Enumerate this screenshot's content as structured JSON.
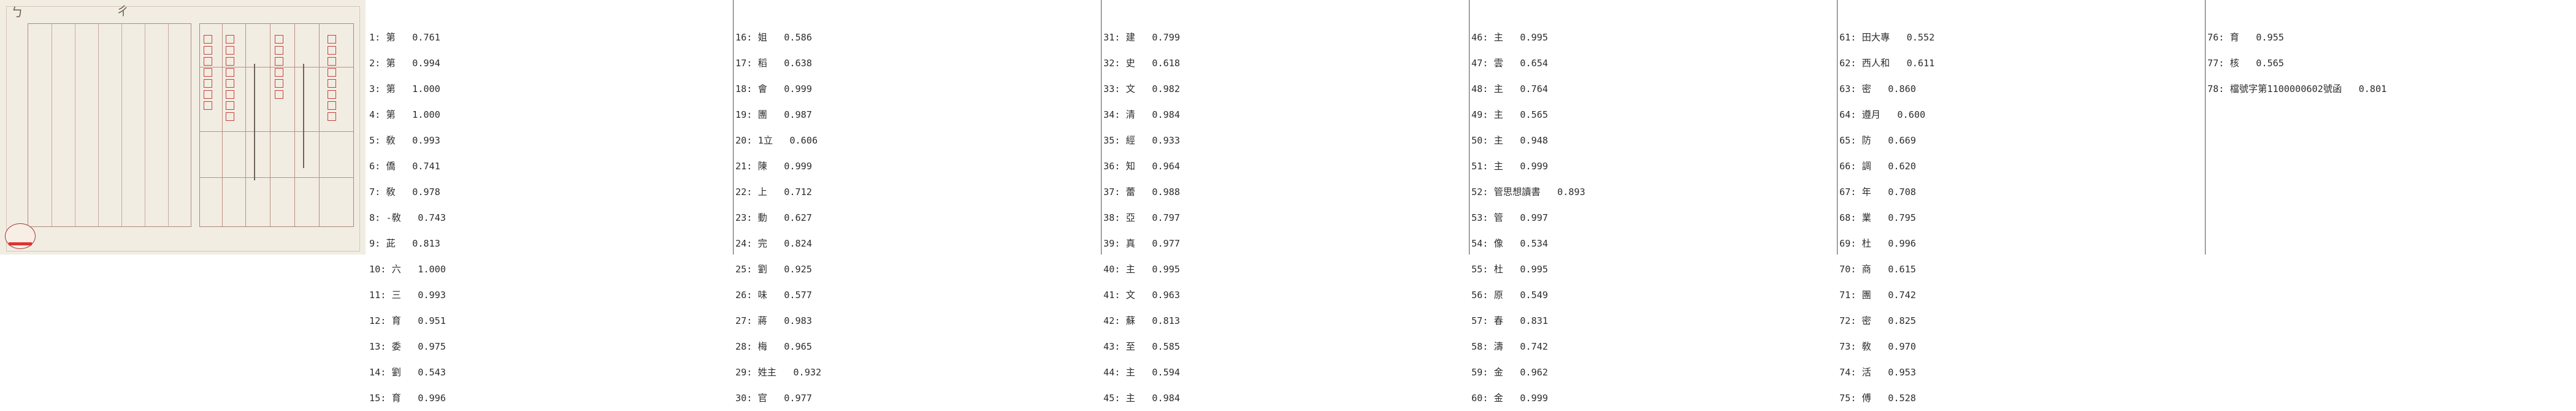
{
  "columns": [
    [
      [
        "1:",
        "第",
        "0.761"
      ],
      [
        "2:",
        "第",
        "0.994"
      ],
      [
        "3:",
        "第",
        "1.000"
      ],
      [
        "4:",
        "第",
        "1.000"
      ],
      [
        "5:",
        "敎",
        "0.993"
      ],
      [
        "6:",
        "僑",
        "0.741"
      ],
      [
        "7:",
        "敎",
        "0.978"
      ],
      [
        "8:",
        "-敎",
        "0.743"
      ],
      [
        "9:",
        "茈",
        "0.813"
      ],
      [
        "10:",
        "六",
        "1.000"
      ],
      [
        "11:",
        "三",
        "0.993"
      ],
      [
        "12:",
        "育",
        "0.951"
      ],
      [
        "13:",
        "委",
        "0.975"
      ],
      [
        "14:",
        "劉",
        "0.543"
      ],
      [
        "15:",
        "育",
        "0.996"
      ]
    ],
    [
      [
        "16:",
        "姐",
        "0.586"
      ],
      [
        "17:",
        "稻",
        "0.638"
      ],
      [
        "18:",
        "會",
        "0.999"
      ],
      [
        "19:",
        "團",
        "0.987"
      ],
      [
        "20:",
        "1立",
        "0.606"
      ],
      [
        "21:",
        "陳",
        "0.999"
      ],
      [
        "22:",
        "上",
        "0.712"
      ],
      [
        "23:",
        "動",
        "0.627"
      ],
      [
        "24:",
        "完",
        "0.824"
      ],
      [
        "25:",
        "劉",
        "0.925"
      ],
      [
        "26:",
        "味",
        "0.577"
      ],
      [
        "27:",
        "蔣",
        "0.983"
      ],
      [
        "28:",
        "梅",
        "0.965"
      ],
      [
        "29:",
        "姓主",
        "0.932"
      ],
      [
        "30:",
        "官",
        "0.977"
      ]
    ],
    [
      [
        "31:",
        "建",
        "0.799"
      ],
      [
        "32:",
        "史",
        "0.618"
      ],
      [
        "33:",
        "文",
        "0.982"
      ],
      [
        "34:",
        "清",
        "0.984"
      ],
      [
        "35:",
        "經",
        "0.933"
      ],
      [
        "36:",
        "知",
        "0.964"
      ],
      [
        "37:",
        "蕾",
        "0.988"
      ],
      [
        "38:",
        "亞",
        "0.797"
      ],
      [
        "39:",
        "真",
        "0.977"
      ],
      [
        "40:",
        "主",
        "0.995"
      ],
      [
        "41:",
        "文",
        "0.963"
      ],
      [
        "42:",
        "蘇",
        "0.813"
      ],
      [
        "43:",
        "至",
        "0.585"
      ],
      [
        "44:",
        "主",
        "0.594"
      ],
      [
        "45:",
        "主",
        "0.984"
      ]
    ],
    [
      [
        "46:",
        "主",
        "0.995"
      ],
      [
        "47:",
        "雲",
        "0.654"
      ],
      [
        "48:",
        "主",
        "0.764"
      ],
      [
        "49:",
        "主",
        "0.565"
      ],
      [
        "50:",
        "主",
        "0.948"
      ],
      [
        "51:",
        "主",
        "0.999"
      ],
      [
        "52:",
        "管思想讀書",
        "0.893"
      ],
      [
        "53:",
        "管",
        "0.997"
      ],
      [
        "54:",
        "像",
        "0.534"
      ],
      [
        "55:",
        "杜",
        "0.995"
      ],
      [
        "56:",
        "原",
        "0.549"
      ],
      [
        "57:",
        "春",
        "0.831"
      ],
      [
        "58:",
        "濤",
        "0.742"
      ],
      [
        "59:",
        "金",
        "0.962"
      ],
      [
        "60:",
        "金",
        "0.999"
      ]
    ],
    [
      [
        "61:",
        "田大專",
        "0.552"
      ],
      [
        "62:",
        "西人和",
        "0.611"
      ],
      [
        "63:",
        "密",
        "0.860"
      ],
      [
        "64:",
        "遵月",
        "0.600"
      ],
      [
        "65:",
        "防",
        "0.669"
      ],
      [
        "66:",
        "調",
        "0.620"
      ],
      [
        "67:",
        "年",
        "0.708"
      ],
      [
        "68:",
        "業",
        "0.795"
      ],
      [
        "69:",
        "杜",
        "0.996"
      ],
      [
        "70:",
        "商",
        "0.615"
      ],
      [
        "71:",
        "團",
        "0.742"
      ],
      [
        "72:",
        "密",
        "0.825"
      ],
      [
        "73:",
        "敎",
        "0.970"
      ],
      [
        "74:",
        "活",
        "0.953"
      ],
      [
        "75:",
        "傅",
        "0.528"
      ]
    ],
    [
      [
        "76:",
        "育",
        "0.955"
      ],
      [
        "77:",
        "核",
        "0.565"
      ],
      [
        "78:",
        "檔號字第1100000602號函",
        "0.801"
      ]
    ]
  ]
}
